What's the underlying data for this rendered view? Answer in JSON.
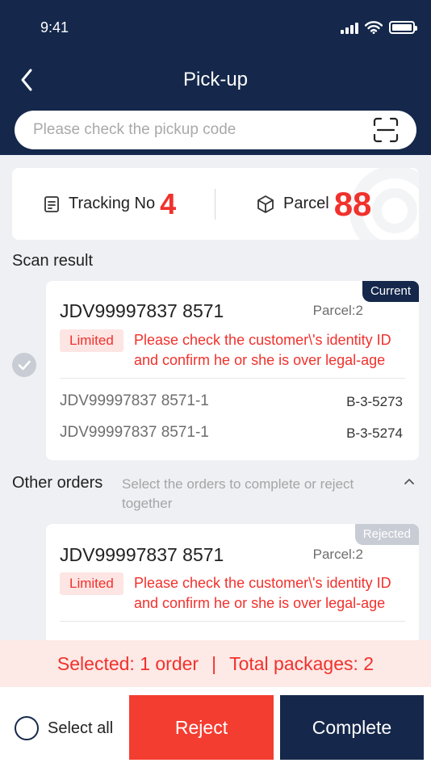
{
  "status_bar": {
    "time": "9:41"
  },
  "header": {
    "title": "Pick-up"
  },
  "search": {
    "placeholder": "Please check the pickup code"
  },
  "stats": {
    "tracking_label": "Tracking No",
    "tracking_value": "4",
    "parcel_label": "Parcel",
    "parcel_value": "88"
  },
  "scan_result": {
    "title": "Scan result",
    "order": {
      "badge": "Current",
      "order_no": "JDV99997837 8571",
      "parcel_count": "Parcel:2",
      "tag": "Limited",
      "message": "Please check the customer\\'s identity ID and confirm he or she is over legal-age",
      "items": [
        {
          "no": "JDV99997837 8571-1",
          "location": "B-3-5273"
        },
        {
          "no": "JDV99997837 8571-1",
          "location": "B-3-5274"
        }
      ]
    }
  },
  "other_orders": {
    "title": "Other orders",
    "subtitle": "Select the orders to complete or reject together",
    "order": {
      "badge": "Rejected",
      "order_no": "JDV99997837 8571",
      "parcel_count": "Parcel:2",
      "tag": "Limited",
      "message": "Please check the customer\\'s identity ID and confirm he or she is over legal-age"
    }
  },
  "summary": {
    "selected": "Selected: 1 order",
    "separator": "|",
    "total": "Total packages: 2"
  },
  "actions": {
    "select_all": "Select all",
    "reject": "Reject",
    "complete": "Complete"
  },
  "colors": {
    "navy": "#15284b",
    "red": "#f1312c",
    "reject_button": "#f33d31"
  },
  "icons": [
    "back-chevron-icon",
    "scan-icon",
    "document-icon",
    "box-icon",
    "check-circle-icon",
    "chevron-up-icon",
    "radio-circle-icon",
    "signal-icon",
    "wifi-icon",
    "battery-icon"
  ]
}
